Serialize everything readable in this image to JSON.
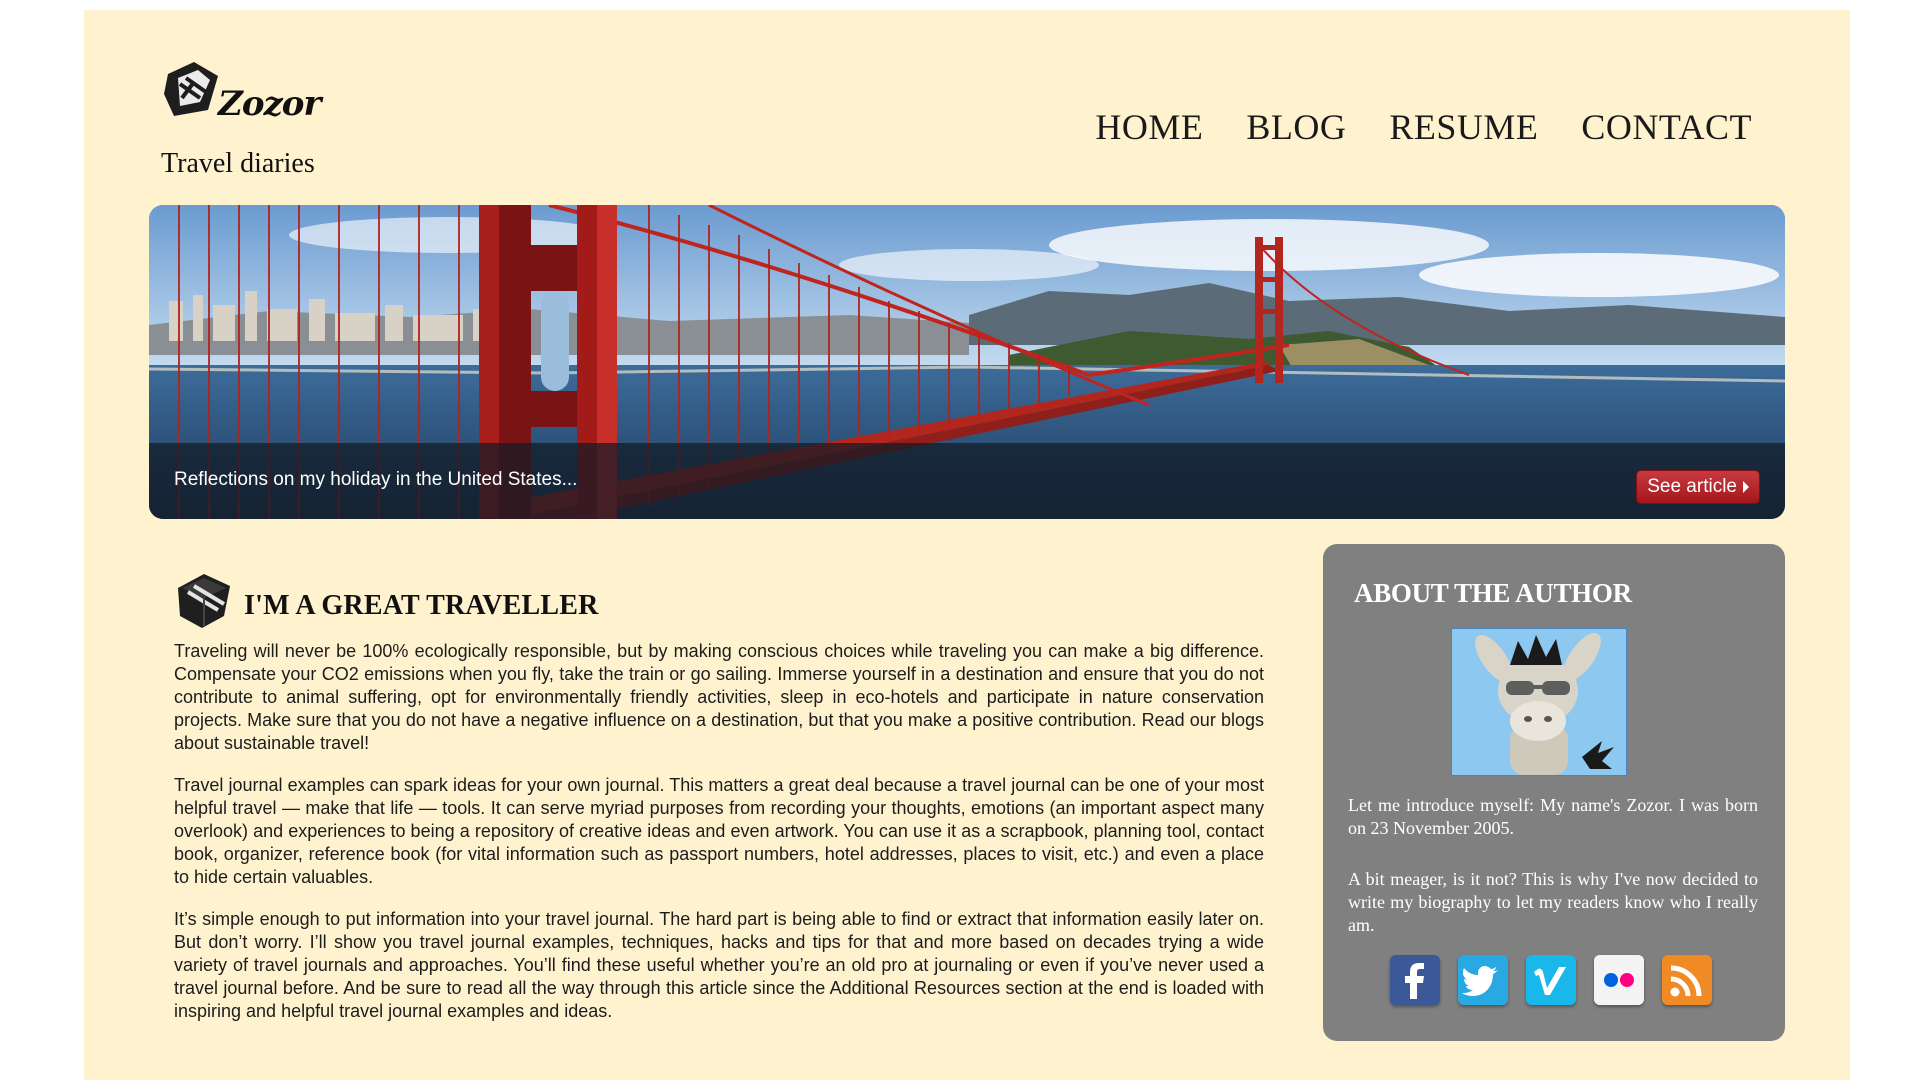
{
  "site": {
    "brand": "Zozor",
    "tagline": "Travel diaries"
  },
  "nav": {
    "items": [
      {
        "label": "HOME"
      },
      {
        "label": "BLOG"
      },
      {
        "label": "RESUME"
      },
      {
        "label": "CONTACT"
      }
    ]
  },
  "banner": {
    "image": "golden-gate-bridge-photo",
    "caption": "Reflections on my holiday in the United States...",
    "button_label": "See article",
    "button_icon": "caret-right-icon"
  },
  "article": {
    "icon": "tie-icon",
    "title": "I'M A GREAT TRAVELLER",
    "paragraphs": [
      "Traveling will never be 100% ecologically responsible, but by making conscious choices while traveling you can make a big difference. Compensate your CO2 emissions when you fly, take the train or go sailing. Immerse yourself in a destination and ensure that you do not contribute to animal suffering, opt for environmentally friendly activities, sleep in eco-hotels and participate in nature conservation projects. Make sure that you do not have a negative influence on a destination, but that you make a positive contribution. Read our blogs about sustainable travel!",
      "Travel journal examples can spark ideas for your own journal. This matters a great deal because a travel journal can be one of your most helpful travel — make that life — tools. It can serve myriad purposes from recording your thoughts, emotions (an important aspect many overlook) and experiences to being a repository of creative ideas and even artwork. You can use it as a scrapbook, planning tool, contact book, organizer, reference book (for vital information such as passport numbers, hotel addresses, places to visit, etc.) and even a place to hide certain valuables.",
      "It’s simple enough to put information into your travel journal. The hard part is being able to find or extract that information easily later on. But don’t worry. I’ll show you travel journal examples, techniques, hacks and tips for that and more based on decades trying a wide variety of travel journals and approaches. You’ll find these useful whether you’re an old pro at journaling or even if you’ve never used a travel journal before. And be sure to read all the way through this article since the Additional Resources section at the end is loaded with inspiring and helpful travel journal examples and ideas."
    ]
  },
  "author": {
    "title": "ABOUT THE AUTHOR",
    "avatar": "zozor-donkey-avatar",
    "paragraphs": [
      "Let me introduce myself: My name's Zozor. I was born on 23 November 2005.",
      "A bit meager, is it not? This is why I've now decided to write my biography to let my readers know who I really am."
    ],
    "social": [
      {
        "name": "facebook",
        "icon": "facebook-icon",
        "color": "#3b5998"
      },
      {
        "name": "twitter",
        "icon": "twitter-icon",
        "color": "#29a9e1"
      },
      {
        "name": "vimeo",
        "icon": "vimeo-icon",
        "color": "#1ab7ea"
      },
      {
        "name": "flickr",
        "icon": "flickr-icon",
        "color": "#ffffff"
      },
      {
        "name": "rss",
        "icon": "rss-icon",
        "color": "#f08a24"
      }
    ]
  },
  "colors": {
    "page_background": "#fff3cf",
    "sidebar_background": "#808080",
    "button_red": "#b3262b",
    "bridge_red": "#c0241f"
  }
}
